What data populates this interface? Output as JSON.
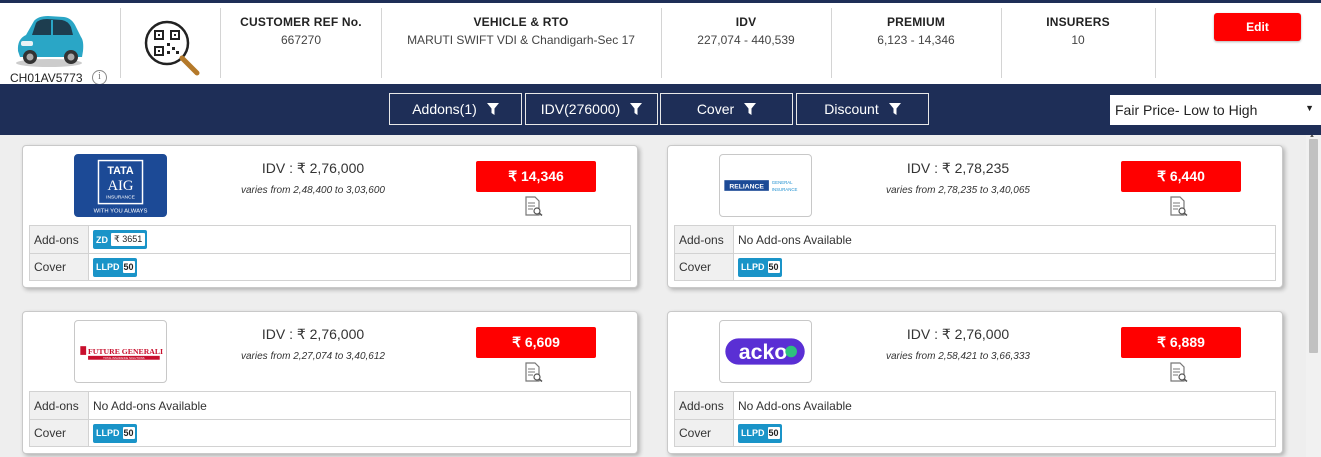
{
  "vehicle": {
    "registration": "CH01AV5773",
    "info_symbol": "i"
  },
  "summary": [
    {
      "label": "CUSTOMER REF No.",
      "value": "667270"
    },
    {
      "label": "VEHICLE & RTO",
      "value": "MARUTI SWIFT VDI & Chandigarh-Sec 17"
    },
    {
      "label": "IDV",
      "value": "227,074 - 440,539"
    },
    {
      "label": "PREMIUM",
      "value": "6,123 - 14,346"
    },
    {
      "label": "INSURERS",
      "value": "10"
    }
  ],
  "edit_label": "Edit",
  "filters": [
    {
      "label": "Addons(1)"
    },
    {
      "label": "IDV(276000)"
    },
    {
      "label": "Cover"
    },
    {
      "label": "Discount"
    }
  ],
  "sort": {
    "selected": "Fair Price- Low to High"
  },
  "colors": {
    "navy": "#1e2e57",
    "red": "#ff0000",
    "tag_blue": "#1a94c8"
  },
  "row_labels": {
    "addons": "Add-ons",
    "cover": "Cover"
  },
  "quotes": [
    {
      "insurer_logo": "tata-aig-logo",
      "logo_text": {
        "l1": "TATA",
        "l2": "AIG",
        "l3": "INSURANCE",
        "l4": "WITH YOU ALWAYS"
      },
      "idv": "IDV : ₹ 2,76,000",
      "varies": "varies from 2,48,400 to 3,03,600",
      "premium": "₹ 14,346",
      "addon": {
        "code": "ZD",
        "amount": "₹ 3651"
      },
      "addons_text": "",
      "cover": {
        "code": "LLPD",
        "amount": "50"
      }
    },
    {
      "insurer_logo": "reliance-logo",
      "logo_text": {
        "l1": "RELIANCE",
        "l2": "GENERAL",
        "l3": "INSURANCE"
      },
      "idv": "IDV : ₹ 2,78,235",
      "varies": "varies from 2,78,235 to 3,40,065",
      "premium": "₹ 6,440",
      "addons_text": "No Add-ons Available",
      "cover": {
        "code": "LLPD",
        "amount": "50"
      }
    },
    {
      "insurer_logo": "future-generali-logo",
      "logo_text": {
        "l1": "FUTURE GENERALI",
        "l2": "TOTAL INSURANCE SOLUTIONS"
      },
      "idv": "IDV : ₹ 2,76,000",
      "varies": "varies from 2,27,074 to 3,40,612",
      "premium": "₹ 6,609",
      "addons_text": "No Add-ons Available",
      "cover": {
        "code": "LLPD",
        "amount": "50"
      }
    },
    {
      "insurer_logo": "acko-logo",
      "logo_text": {
        "l1": "acko"
      },
      "idv": "IDV : ₹ 2,76,000",
      "varies": "varies from 2,58,421 to 3,66,333",
      "premium": "₹ 6,889",
      "addons_text": "No Add-ons Available",
      "cover": {
        "code": "LLPD",
        "amount": "50"
      }
    }
  ]
}
